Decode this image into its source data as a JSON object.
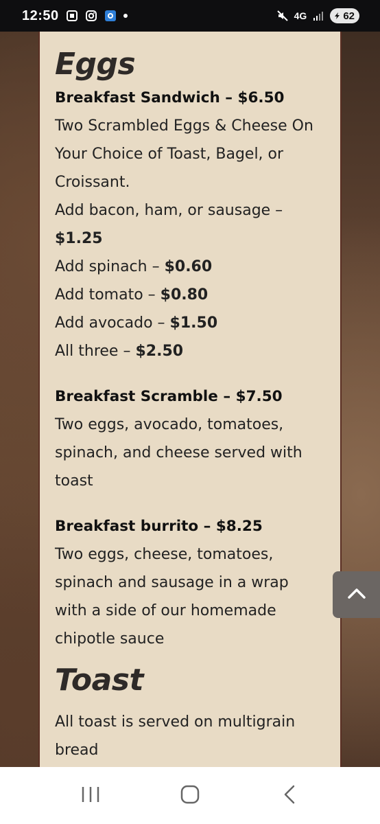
{
  "status_bar": {
    "time": "12:50",
    "network": "4G",
    "battery": "62",
    "icons": [
      "screenshot-icon",
      "instagram-icon",
      "app-icon",
      "notification-dot",
      "mute-icon",
      "signal-icon",
      "battery-icon"
    ]
  },
  "menu": {
    "sections": [
      {
        "title": "Eggs",
        "items": [
          {
            "name": "Breakfast Sandwich – $6.50",
            "lines": [
              {
                "text": "Two Scrambled Eggs & Cheese On"
              },
              {
                "text": "Your Choice of Toast, Bagel, or"
              },
              {
                "text": "Croissant."
              },
              {
                "text": "Add bacon, ham, or sausage –"
              },
              {
                "text": "",
                "price": "$1.25"
              },
              {
                "text": "Add spinach – ",
                "price": "$0.60"
              },
              {
                "text": "Add tomato – ",
                "price": "$0.80"
              },
              {
                "text": "Add avocado – ",
                "price": "$1.50"
              },
              {
                "text": "All three – ",
                "price": "$2.50"
              }
            ]
          },
          {
            "name": "Breakfast Scramble – $7.50",
            "lines": [
              {
                "text": "Two eggs, avocado, tomatoes,"
              },
              {
                "text": "spinach, and cheese served with"
              },
              {
                "text": "toast"
              }
            ]
          },
          {
            "name": "Breakfast burrito – $8.25",
            "lines": [
              {
                "text": "Two eggs, cheese, tomatoes,"
              },
              {
                "text": "spinach and sausage in a wrap"
              },
              {
                "text": "with a side of our homemade"
              },
              {
                "text": "chipotle sauce"
              }
            ]
          }
        ]
      },
      {
        "title": "Toast",
        "lines": [
          {
            "text": "All toast is served on multigrain"
          },
          {
            "text": "bread"
          }
        ]
      }
    ]
  },
  "scroll_top_button": {
    "icon": "chevron-up-icon"
  },
  "nav_bar": {
    "buttons": [
      {
        "name": "recent-apps-button",
        "icon": "recent-apps-icon"
      },
      {
        "name": "home-button",
        "icon": "home-icon"
      },
      {
        "name": "back-button",
        "icon": "back-icon"
      }
    ]
  },
  "colors": {
    "panel": "#e8dbc5",
    "panel_border": "#5a2f24",
    "status_bar": "#0e0e10"
  }
}
